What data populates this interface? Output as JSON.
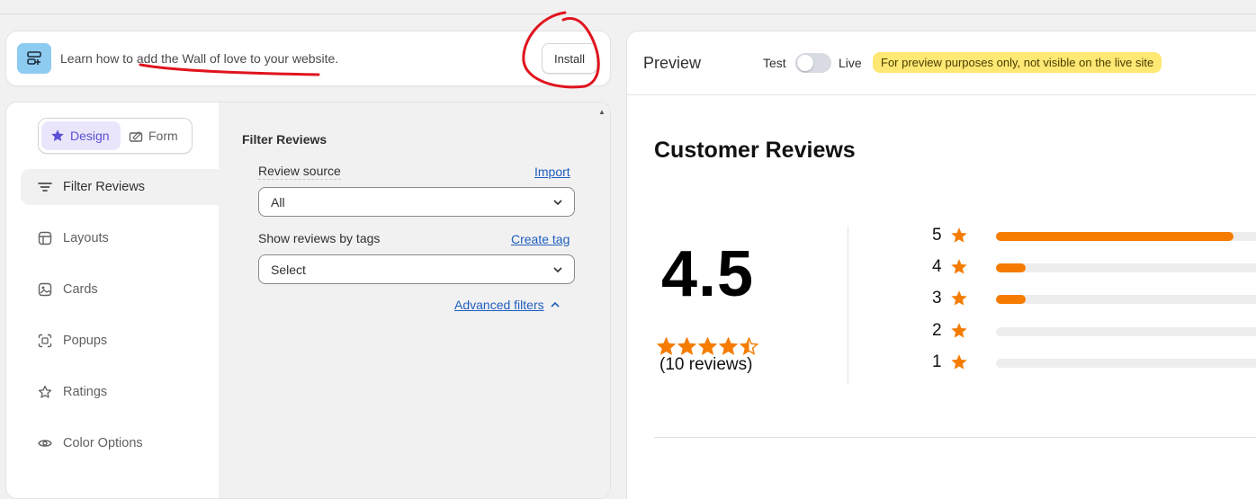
{
  "banner": {
    "text": "Learn how to add the Wall of love to your website.",
    "install_label": "Install"
  },
  "toggle": {
    "design_label": "Design",
    "form_label": "Form"
  },
  "sidebar": {
    "items": [
      {
        "label": "Filter Reviews",
        "icon": "filter-lines-icon"
      },
      {
        "label": "Layouts",
        "icon": "layout-icon"
      },
      {
        "label": "Cards",
        "icon": "card-image-icon"
      },
      {
        "label": "Popups",
        "icon": "popup-icon"
      },
      {
        "label": "Ratings",
        "icon": "star-outline-icon"
      },
      {
        "label": "Color Options",
        "icon": "eye-icon"
      }
    ]
  },
  "filter": {
    "title": "Filter Reviews",
    "review_source_label": "Review source",
    "import_link": "Import",
    "review_source_value": "All",
    "tags_label": "Show reviews by tags",
    "create_tag_link": "Create tag",
    "tags_value": "Select",
    "advanced_link": "Advanced filters"
  },
  "preview": {
    "title": "Preview",
    "test_label": "Test",
    "live_label": "Live",
    "badge": "For preview purposes only, not visible on the live site",
    "reviews_title": "Customer Reviews",
    "rating": "4.5",
    "rating_value": 4.5,
    "review_count": "(10 reviews)",
    "distribution": [
      {
        "stars": "5",
        "fraction": 0.8
      },
      {
        "stars": "4",
        "fraction": 0.1
      },
      {
        "stars": "3",
        "fraction": 0.1
      },
      {
        "stars": "2",
        "fraction": 0.0
      },
      {
        "stars": "1",
        "fraction": 0.0
      }
    ]
  },
  "colors": {
    "accent_purple": "#5b4fd6",
    "star_orange": "#f57c00",
    "link_blue": "#1f5fbf",
    "badge_yellow": "#ffe873",
    "annotation_red": "#e0141e"
  }
}
